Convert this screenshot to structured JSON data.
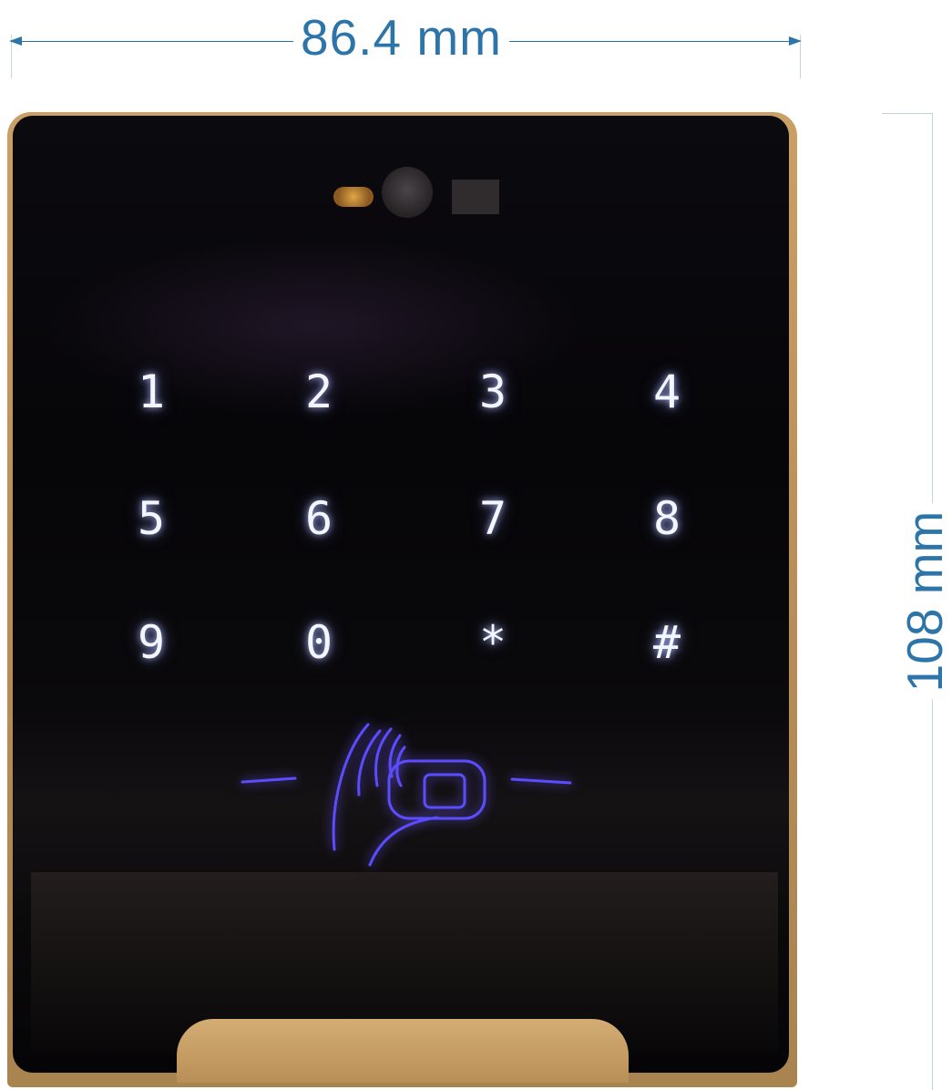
{
  "dimensions": {
    "width_label": "86.4 mm",
    "height_label": "108 mm",
    "line_color": "#2d74a8"
  },
  "device": {
    "frame_color": "#c19a63",
    "glass_color": "#08070a",
    "backlight_color": "#6a5cff",
    "keys": [
      "1",
      "2",
      "3",
      "4",
      "5",
      "6",
      "7",
      "8",
      "9",
      "0",
      "*",
      "#"
    ],
    "card_reader_icon": "rfid-card-icon"
  }
}
